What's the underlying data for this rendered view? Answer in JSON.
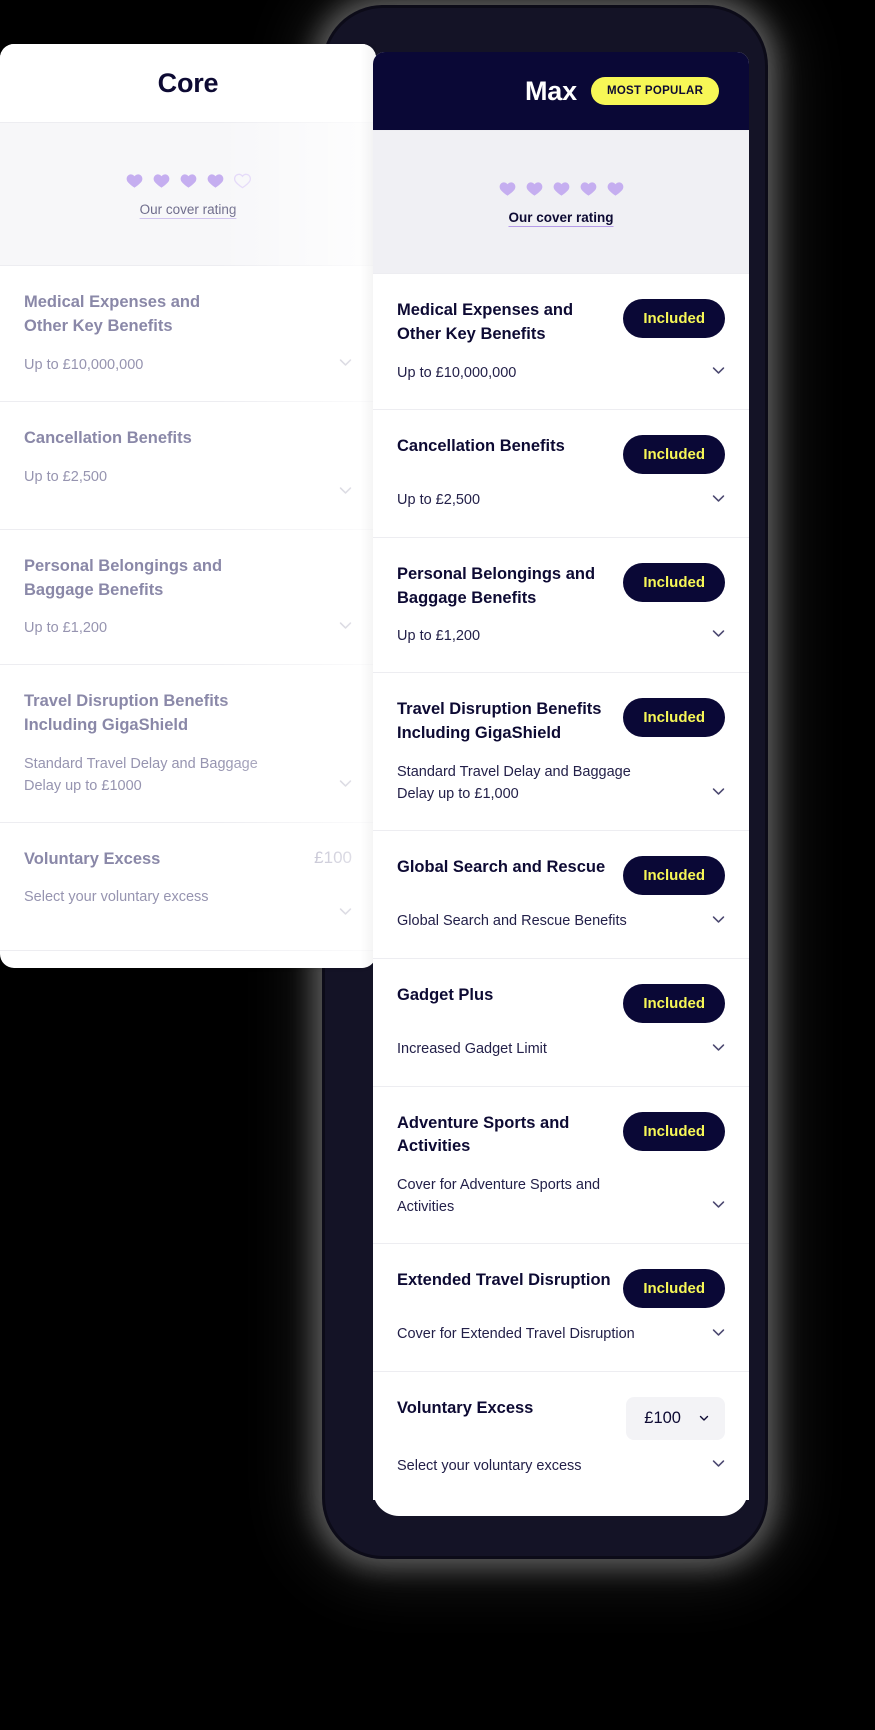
{
  "core": {
    "plan_title": "Core",
    "rating": {
      "label": "Our cover rating",
      "filled": 4,
      "total": 5
    },
    "rows": [
      {
        "title": "Medical Expenses and Other Key Benefits",
        "sub": "Up to £10,000,000",
        "right_kind": "none",
        "right_text": ""
      },
      {
        "title": "Cancellation Benefits",
        "sub": "Up to £2,500",
        "right_kind": "none",
        "right_text": ""
      },
      {
        "title": "Personal Belongings and Baggage Benefits",
        "sub": "Up to £1,200",
        "right_kind": "none",
        "right_text": ""
      },
      {
        "title": "Travel Disruption Benefits Including GigaShield",
        "sub": "Standard Travel Delay and Baggage Delay up to £1000",
        "right_kind": "none",
        "right_text": ""
      },
      {
        "title": "Voluntary Excess",
        "sub": "Select your voluntary excess",
        "right_kind": "value",
        "right_text": "£100"
      }
    ]
  },
  "max": {
    "plan_title": "Max",
    "popular_badge": "MOST POPULAR",
    "rating": {
      "label": "Our cover rating",
      "filled": 5,
      "total": 5
    },
    "included_label": "Included",
    "rows": [
      {
        "title": "Medical Expenses and Other Key Benefits",
        "sub": "Up to £10,000,000",
        "right_kind": "included",
        "right_text": "Included"
      },
      {
        "title": "Cancellation Benefits",
        "sub": "Up to £2,500",
        "right_kind": "included",
        "right_text": "Included"
      },
      {
        "title": "Personal Belongings and Baggage Benefits",
        "sub": "Up to £1,200",
        "right_kind": "included",
        "right_text": "Included"
      },
      {
        "title": "Travel Disruption Benefits Including GigaShield",
        "sub": "Standard Travel Delay and Baggage Delay up to £1,000",
        "right_kind": "included",
        "right_text": "Included"
      },
      {
        "title": "Global Search and Rescue",
        "sub": "Global Search and Rescue Benefits",
        "right_kind": "included",
        "right_text": "Included"
      },
      {
        "title": "Gadget Plus",
        "sub": "Increased Gadget Limit",
        "right_kind": "included",
        "right_text": "Included"
      },
      {
        "title": "Adventure Sports and Activities",
        "sub": "Cover for Adventure Sports and Activities",
        "right_kind": "included",
        "right_text": "Included"
      },
      {
        "title": "Extended Travel Disruption",
        "sub": "Cover for Extended Travel Disruption",
        "right_kind": "included",
        "right_text": "Included"
      },
      {
        "title": "Voluntary Excess",
        "sub": "Select your voluntary excess",
        "right_kind": "select",
        "right_text": "£100"
      }
    ]
  },
  "icons": {
    "heart_filled": "heart-filled-icon",
    "heart_empty": "heart-outline-icon",
    "chevron": "chevron-down-icon",
    "select_caret": "caret-down-icon"
  },
  "colors": {
    "navy": "#0a0836",
    "yellow": "#f7f756",
    "heart_purple": "#c5aef0",
    "muted_text": "#9694b0"
  }
}
